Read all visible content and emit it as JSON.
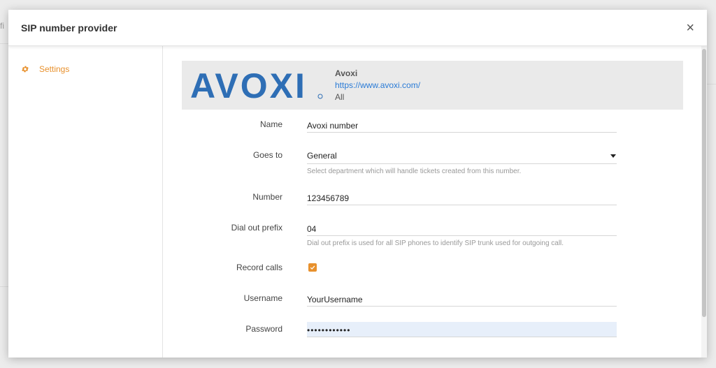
{
  "modal": {
    "title": "SIP number provider",
    "close_label": "×"
  },
  "sidebar": {
    "items": [
      {
        "label": "Settings",
        "icon": "gear-icon",
        "color": "#e8912d"
      }
    ]
  },
  "provider": {
    "logo_text": "AVOXI",
    "name": "Avoxi",
    "url": "https://www.avoxi.com/",
    "scope": "All"
  },
  "form": {
    "name": {
      "label": "Name",
      "value": "Avoxi number"
    },
    "goes_to": {
      "label": "Goes to",
      "value": "General",
      "hint": "Select department which will handle tickets created from this number."
    },
    "number": {
      "label": "Number",
      "value": "123456789"
    },
    "dial_out_prefix": {
      "label": "Dial out prefix",
      "value": "04",
      "hint": "Dial out prefix is used for all SIP phones to identify SIP trunk used for outgoing call."
    },
    "record_calls": {
      "label": "Record calls",
      "checked": true
    },
    "username": {
      "label": "Username",
      "value": "YourUsername"
    },
    "password": {
      "label": "Password",
      "value": "••••••••••••"
    }
  },
  "colors": {
    "accent": "#e8912d",
    "link": "#2a7bd6",
    "logo_blue": "#2e6eb5"
  },
  "background": {
    "fragment": "fi"
  }
}
